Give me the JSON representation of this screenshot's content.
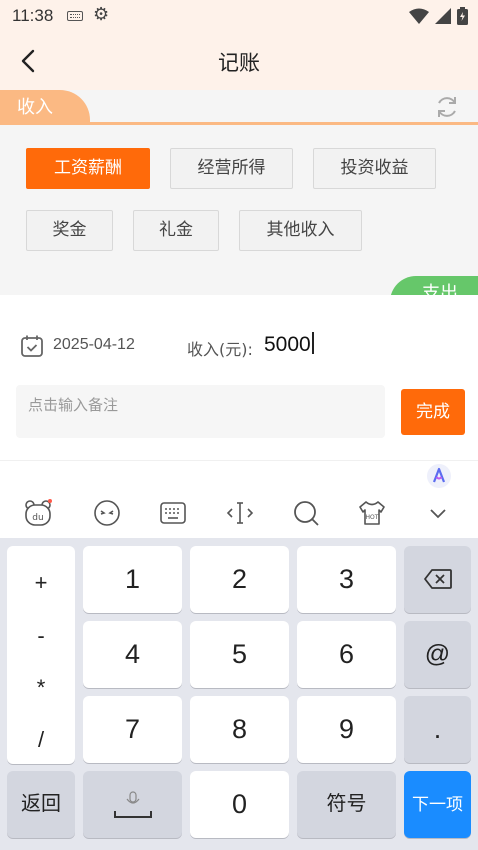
{
  "status_bar": {
    "time": "11:38"
  },
  "header": {
    "title": "记账"
  },
  "tabs": {
    "income": "收入",
    "expense": "支出"
  },
  "categories": [
    {
      "label": "工资薪酬",
      "active": true
    },
    {
      "label": "经营所得",
      "active": false
    },
    {
      "label": "投资收益",
      "active": false
    },
    {
      "label": "奖金",
      "active": false
    },
    {
      "label": "礼金",
      "active": false
    },
    {
      "label": "其他收入",
      "active": false
    }
  ],
  "form": {
    "date": "2025-04-12",
    "amount_label": "收入(元):",
    "amount_value": "5000",
    "note_placeholder": "点击输入备注",
    "done_label": "完成"
  },
  "keyboard": {
    "symbols": [
      "+",
      "-",
      "*",
      "/"
    ],
    "numbers": [
      "1",
      "2",
      "3",
      "4",
      "5",
      "6",
      "7",
      "8",
      "9",
      "0"
    ],
    "at": "@",
    "dot": ".",
    "back_label": "返回",
    "symbol_label": "符号",
    "next_label": "下一项"
  },
  "colors": {
    "accent": "#ff6a0a",
    "expense": "#66c76a",
    "keyboard_blue": "#1a8cff"
  }
}
